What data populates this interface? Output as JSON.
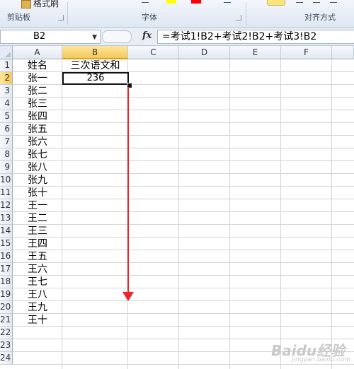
{
  "ribbon": {
    "format_painter_label": "格式刷",
    "clipboard_group": "剪贴板",
    "font_group": "字体",
    "align_group": "对齐方式",
    "colors": {
      "highlight": "#ffff00",
      "font_color": "#ff0000"
    }
  },
  "formula_bar": {
    "name_box": "B2",
    "fx_label": "fx",
    "formula": "=考试1!B2+考试2!B2+考试3!B2"
  },
  "columns": [
    "A",
    "B",
    "C",
    "D",
    "E",
    "F"
  ],
  "rows": [
    "1",
    "2",
    "3",
    "4",
    "5",
    "6",
    "7",
    "8",
    "9",
    "10",
    "11",
    "12",
    "13",
    "14",
    "15",
    "16",
    "17",
    "18",
    "19",
    "20",
    "21",
    "22",
    "23",
    "24"
  ],
  "cells": {
    "A": [
      "姓名",
      "张一",
      "张二",
      "张三",
      "张四",
      "张五",
      "张六",
      "张七",
      "张八",
      "张九",
      "张十",
      "王一",
      "王二",
      "王三",
      "王四",
      "王五",
      "王六",
      "王七",
      "王八",
      "王九",
      "王十"
    ],
    "B1": "三次语文和",
    "B2": "236"
  },
  "selection": {
    "active_cell": "B2",
    "selected_column": "B",
    "selected_row": "2"
  },
  "annotation": {
    "arrow_color": "#e8262a",
    "direction": "down"
  },
  "watermark": {
    "text": "Baidu经验",
    "sub": "jingyan.baidu.com"
  }
}
